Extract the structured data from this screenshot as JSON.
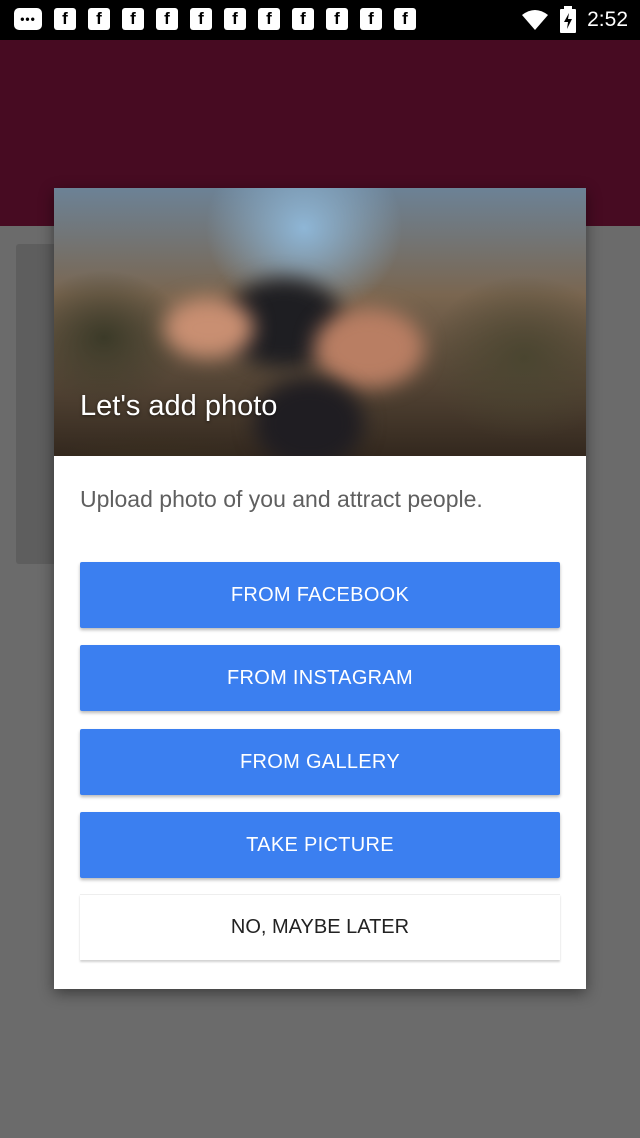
{
  "status_bar": {
    "time": "2:52",
    "notification_glyph": "f",
    "message_glyph": "•••",
    "icons": [
      "message-icon",
      "facebook-icon",
      "wifi-icon",
      "battery-icon"
    ]
  },
  "dialog": {
    "title": "Let's add photo",
    "subtitle": "Upload photo of you and attract people.",
    "buttons": {
      "facebook": "FROM FACEBOOK",
      "instagram": "FROM INSTAGRAM",
      "gallery": "FROM GALLERY",
      "camera": "TAKE PICTURE",
      "later": "NO, MAYBE LATER"
    }
  },
  "colors": {
    "app_header": "#470b22",
    "primary_button": "#3b7ff0",
    "dim_overlay": "#6b6b6b"
  }
}
